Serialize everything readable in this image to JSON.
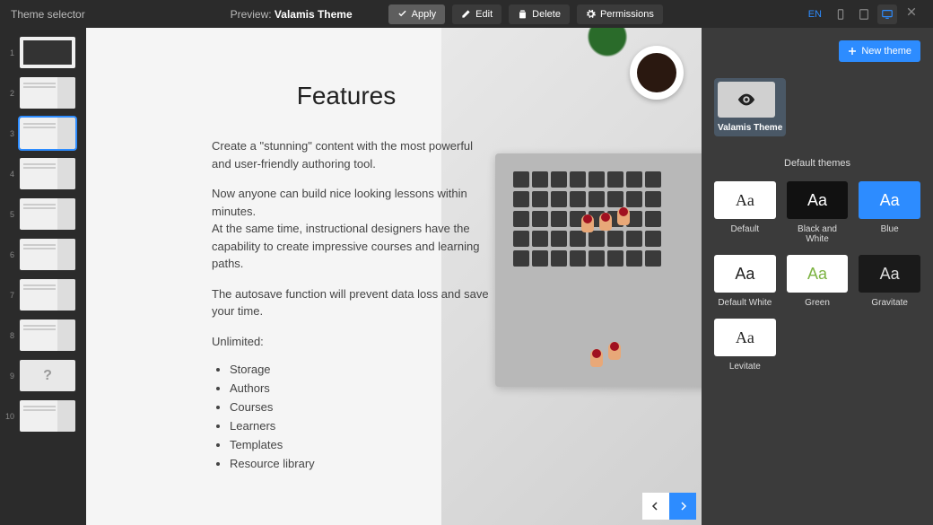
{
  "topbar": {
    "title": "Theme selector",
    "preview_label": "Preview:",
    "preview_theme": "Valamis Theme",
    "apply": "Apply",
    "edit": "Edit",
    "delete": "Delete",
    "permissions": "Permissions",
    "lang": "EN"
  },
  "slides": {
    "count": 10,
    "selected": 3
  },
  "preview": {
    "heading": "Features",
    "p1": "Create a \"stunning\" content with the most powerful and user-friendly authoring tool.",
    "p2a": "Now anyone can build nice looking lessons within minutes.",
    "p2b": "At the same time, instructional designers have the capability to create impressive courses and learning paths.",
    "p3": "The autosave function will prevent data loss and save your time.",
    "p4": "Unlimited:",
    "bullets": [
      "Storage",
      "Authors",
      "Courses",
      "Learners",
      "Templates",
      "Resource library"
    ]
  },
  "panel": {
    "new_theme": "New theme",
    "current_label": "Valamis Theme",
    "section": "Default themes",
    "themes": [
      {
        "name": "Default",
        "bg": "#ffffff",
        "fg": "#222222",
        "font": "serif"
      },
      {
        "name": "Black and White",
        "bg": "#111111",
        "fg": "#ffffff",
        "font": "sans-serif"
      },
      {
        "name": "Blue",
        "bg": "#2d8cff",
        "fg": "#ffffff",
        "font": "sans-serif"
      },
      {
        "name": "Default White",
        "bg": "#ffffff",
        "fg": "#222222",
        "font": "sans-serif"
      },
      {
        "name": "Green",
        "bg": "#ffffff",
        "fg": "#7cb342",
        "font": "sans-serif"
      },
      {
        "name": "Gravitate",
        "bg": "#1a1a1a",
        "fg": "#dddddd",
        "font": "sans-serif"
      },
      {
        "name": "Levitate",
        "bg": "#ffffff",
        "fg": "#222222",
        "font": "serif"
      }
    ]
  }
}
